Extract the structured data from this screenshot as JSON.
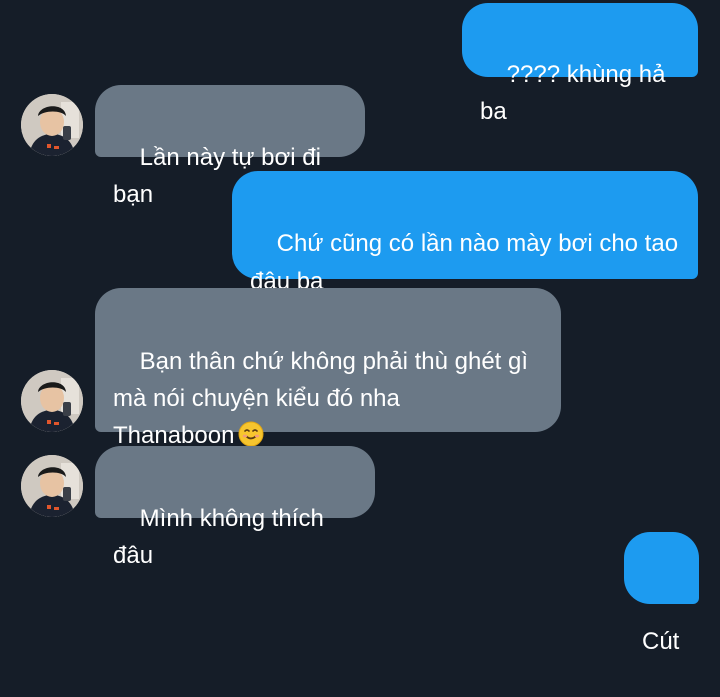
{
  "messages": [
    {
      "id": "m1",
      "direction": "outgoing",
      "text": "???? khùng hả ba"
    },
    {
      "id": "m2",
      "direction": "incoming",
      "text": "Lần này tự bơi đi bạn"
    },
    {
      "id": "m3",
      "direction": "outgoing",
      "text": "Chứ cũng có lần nào mày bơi cho tao\nđâu ba"
    },
    {
      "id": "m4",
      "direction": "incoming",
      "text": "Bạn thân chứ không phải thù ghét gì\nmà nói chuyện kiểu đó nha\nThanaboon",
      "emoji": "smiling-face-icon"
    },
    {
      "id": "m5",
      "direction": "incoming",
      "text": "Mình không thích đâu"
    },
    {
      "id": "m6",
      "direction": "outgoing",
      "text": "Cút"
    }
  ],
  "colors": {
    "background": "#151d28",
    "outgoing_bubble": "#1d9bf0",
    "incoming_bubble": "#6a7886",
    "text": "#ffffff"
  },
  "icons": {
    "avatar": "user-avatar-photo",
    "emoji": "smiling-face-icon"
  }
}
